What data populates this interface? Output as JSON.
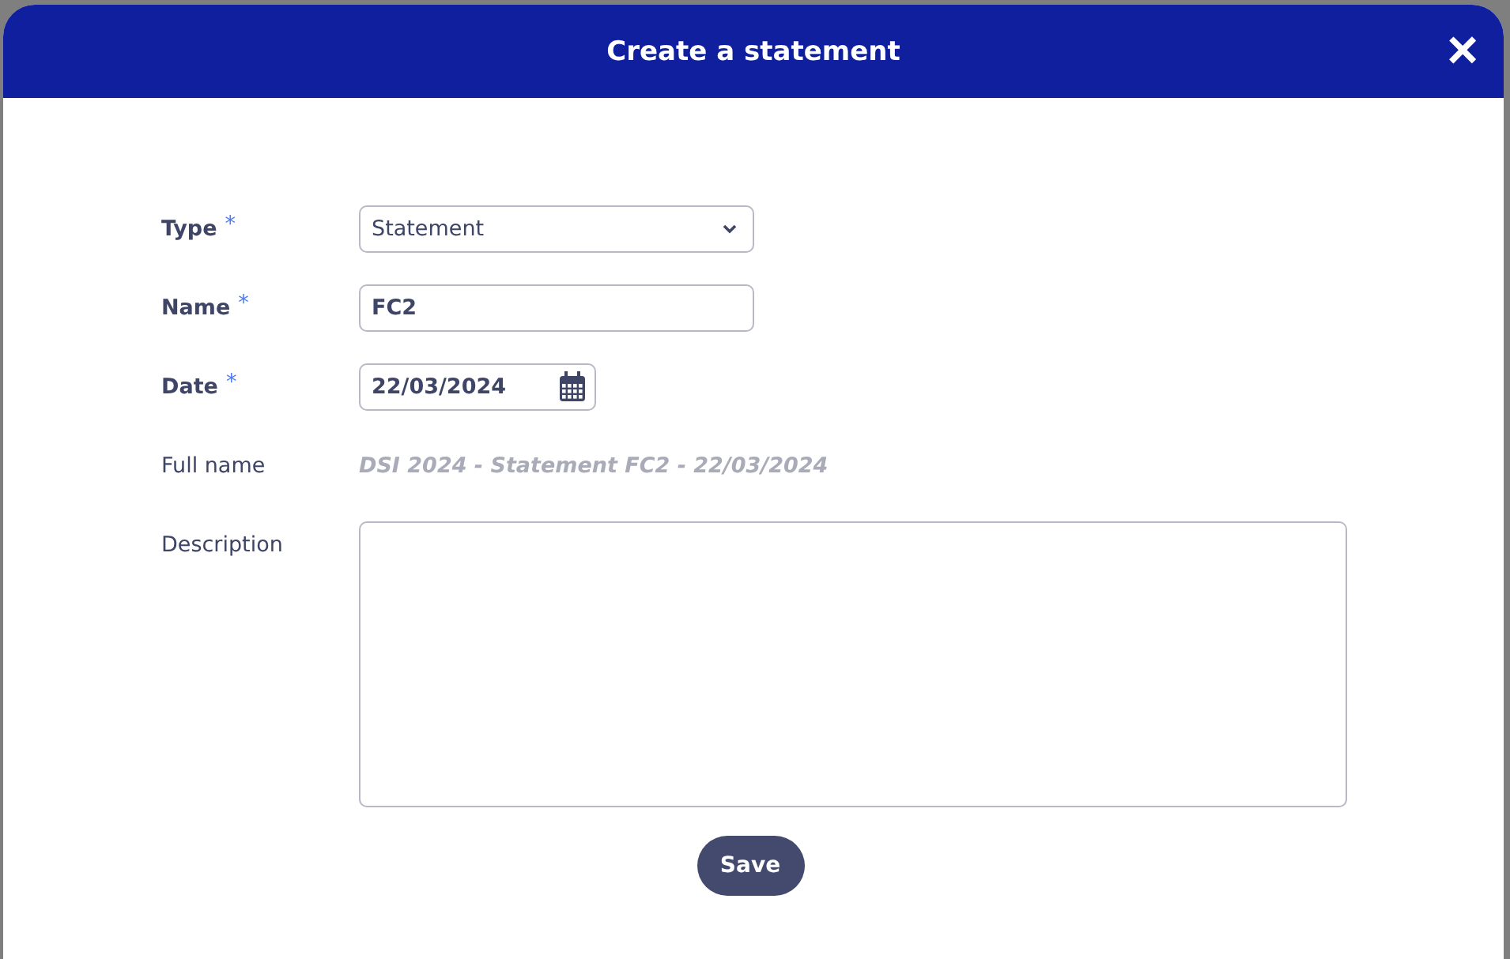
{
  "dialog": {
    "title": "Create a statement",
    "close": "×"
  },
  "fields": [
    {
      "kind": "select",
      "label": "Type",
      "required": true,
      "required_mark": "*",
      "value": "Statement"
    },
    {
      "kind": "text",
      "label": "Name",
      "required": true,
      "required_mark": "*",
      "value": "FC2"
    },
    {
      "kind": "date",
      "label": "Date",
      "required": true,
      "required_mark": "*",
      "value": "22/03/2024"
    },
    {
      "kind": "readonly",
      "label": "Full name",
      "required": false,
      "value": "DSI 2024 - Statement FC2 - 22/03/2024"
    },
    {
      "kind": "textarea",
      "label": "Description",
      "required": false
    }
  ],
  "buttons": [
    "Save"
  ]
}
